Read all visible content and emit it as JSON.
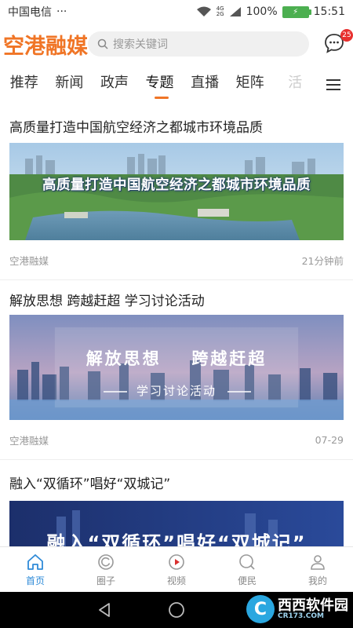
{
  "status_bar": {
    "carrier": "中国电信",
    "dots": "···",
    "network_top": "4G",
    "network_bottom": "2G",
    "battery_percent": "100%",
    "time": "15:51"
  },
  "header": {
    "logo": "空港融媒",
    "search_placeholder": "搜索关键词",
    "message_badge": "25"
  },
  "tabs": {
    "items": [
      "推荐",
      "新闻",
      "政声",
      "专题",
      "直播",
      "矩阵",
      "活"
    ],
    "active_index": 3
  },
  "feed": {
    "items": [
      {
        "title": "高质量打造中国航空经济之都城市环境品质",
        "banner_text": "高质量打造中国航空经济之都城市环境品质",
        "source": "空港融媒",
        "time": "21分钟前"
      },
      {
        "title": "解放思想 跨越赶超 学习讨论活动",
        "banner_text_1": "解放思想",
        "banner_text_2": "跨越赶超",
        "banner_subtext": "学习讨论活动",
        "source": "空港融媒",
        "time": "07-29"
      },
      {
        "title": "融入“双循环”唱好“双城记”",
        "banner_text": "融入“双循环”唱好“双城记”"
      }
    ]
  },
  "bottom_nav": {
    "items": [
      {
        "label": "首页",
        "icon": "home-icon"
      },
      {
        "label": "圈子",
        "icon": "circle-icon"
      },
      {
        "label": "视频",
        "icon": "video-icon"
      },
      {
        "label": "便民",
        "icon": "search-service-icon"
      },
      {
        "label": "我的",
        "icon": "user-icon"
      }
    ],
    "active_index": 0
  },
  "watermark": {
    "mark": "C",
    "text": "西西软件园",
    "url": "CR173.COM"
  },
  "colors": {
    "accent": "#f07526",
    "nav_active": "#2f8bd8",
    "badge": "#e8302f"
  }
}
